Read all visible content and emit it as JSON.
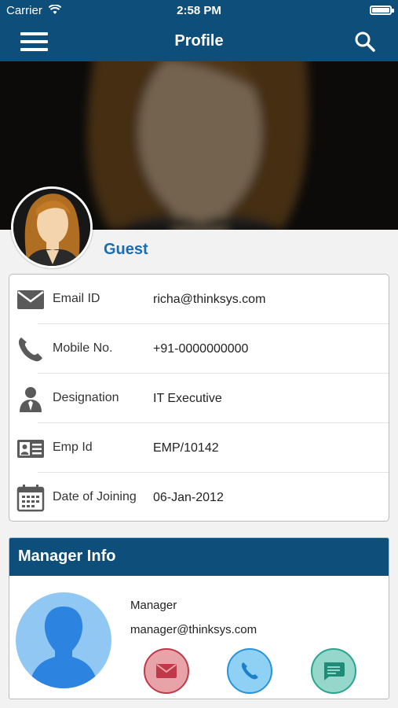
{
  "status_bar": {
    "carrier": "Carrier",
    "time": "2:58 PM"
  },
  "nav": {
    "title": "Profile"
  },
  "profile": {
    "name": "Guest"
  },
  "info_rows": [
    {
      "icon": "envelope-icon",
      "label": "Email ID",
      "value": "richa@thinksys.com"
    },
    {
      "icon": "phone-icon",
      "label": "Mobile No.",
      "value": "+91-0000000000"
    },
    {
      "icon": "person-icon",
      "label": "Designation",
      "value": "IT Executive"
    },
    {
      "icon": "id-card-icon",
      "label": "Emp Id",
      "value": "EMP/10142"
    },
    {
      "icon": "calendar-icon",
      "label": "Date of Joining",
      "value": "06-Jan-2012"
    }
  ],
  "manager": {
    "header": "Manager Info",
    "role": "Manager",
    "email": "manager@thinksys.com",
    "actions": [
      "mail-icon",
      "call-icon",
      "chat-icon"
    ]
  },
  "colors": {
    "primary": "#0d4e7a",
    "accent_link": "#1a6db1",
    "mail_button": "#e8a3a9",
    "call_button": "#8fd0f5",
    "chat_button": "#95d8cb"
  }
}
